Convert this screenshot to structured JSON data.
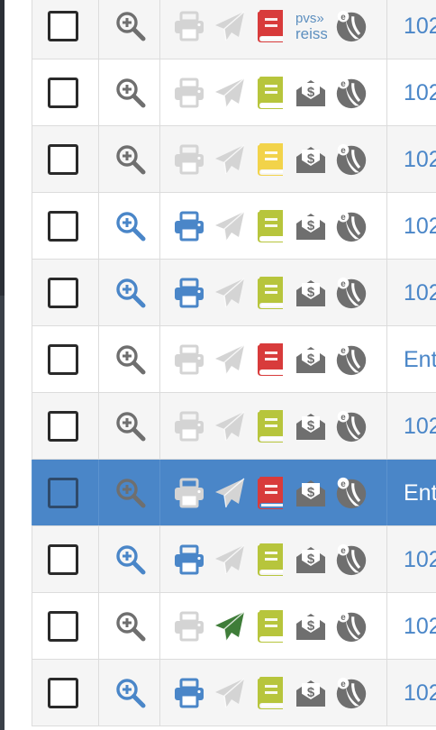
{
  "colors": {
    "accent": "#4a86c8",
    "selected_row": "#4a86c8",
    "book_red": "#d83b3b",
    "book_green": "#b7c53c",
    "book_yellow": "#f2d34a",
    "send_green": "#3f7d39",
    "icon_gray": "#6f6f6f",
    "icon_disabled": "#d4d4d4"
  },
  "rows": [
    {
      "text": "102",
      "zoom": "gray",
      "print": "disabled",
      "send": "disabled",
      "book": "red",
      "pay": "pvs-reiss",
      "selected": false
    },
    {
      "text": "102",
      "zoom": "gray",
      "print": "disabled",
      "send": "disabled",
      "book": "green",
      "pay": "dollar",
      "selected": false
    },
    {
      "text": "102",
      "zoom": "gray",
      "print": "disabled",
      "send": "disabled",
      "book": "yellow",
      "pay": "dollar",
      "selected": false
    },
    {
      "text": "102",
      "zoom": "blue",
      "print": "blue",
      "send": "disabled",
      "book": "green",
      "pay": "dollar",
      "selected": false
    },
    {
      "text": "102",
      "zoom": "blue",
      "print": "blue",
      "send": "disabled",
      "book": "green",
      "pay": "dollar",
      "selected": false
    },
    {
      "text": "Ent",
      "zoom": "gray",
      "print": "disabled",
      "send": "disabled",
      "book": "red",
      "pay": "dollar",
      "selected": false
    },
    {
      "text": "102",
      "zoom": "gray",
      "print": "disabled",
      "send": "disabled",
      "book": "green",
      "pay": "dollar",
      "selected": false
    },
    {
      "text": "Ent",
      "zoom": "gray",
      "print": "disabled",
      "send": "disabled",
      "book": "red",
      "pay": "dollar",
      "selected": true
    },
    {
      "text": "102",
      "zoom": "blue",
      "print": "blue",
      "send": "disabled",
      "book": "green",
      "pay": "dollar",
      "selected": false
    },
    {
      "text": "102",
      "zoom": "gray",
      "print": "disabled",
      "send": "green",
      "book": "green",
      "pay": "dollar",
      "selected": false
    },
    {
      "text": "102",
      "zoom": "blue",
      "print": "blue",
      "send": "disabled",
      "book": "green",
      "pay": "dollar",
      "selected": false
    }
  ],
  "pvs_logo": {
    "line1": "pvs»",
    "line2": "reiss"
  },
  "icon_names": {
    "checkbox": "checkbox",
    "zoom": "magnify-plus-icon",
    "print": "printer-icon",
    "send": "paper-plane-icon",
    "book": "book-icon",
    "pay": "envelope-dollar-icon",
    "e": "e-signature-icon"
  }
}
